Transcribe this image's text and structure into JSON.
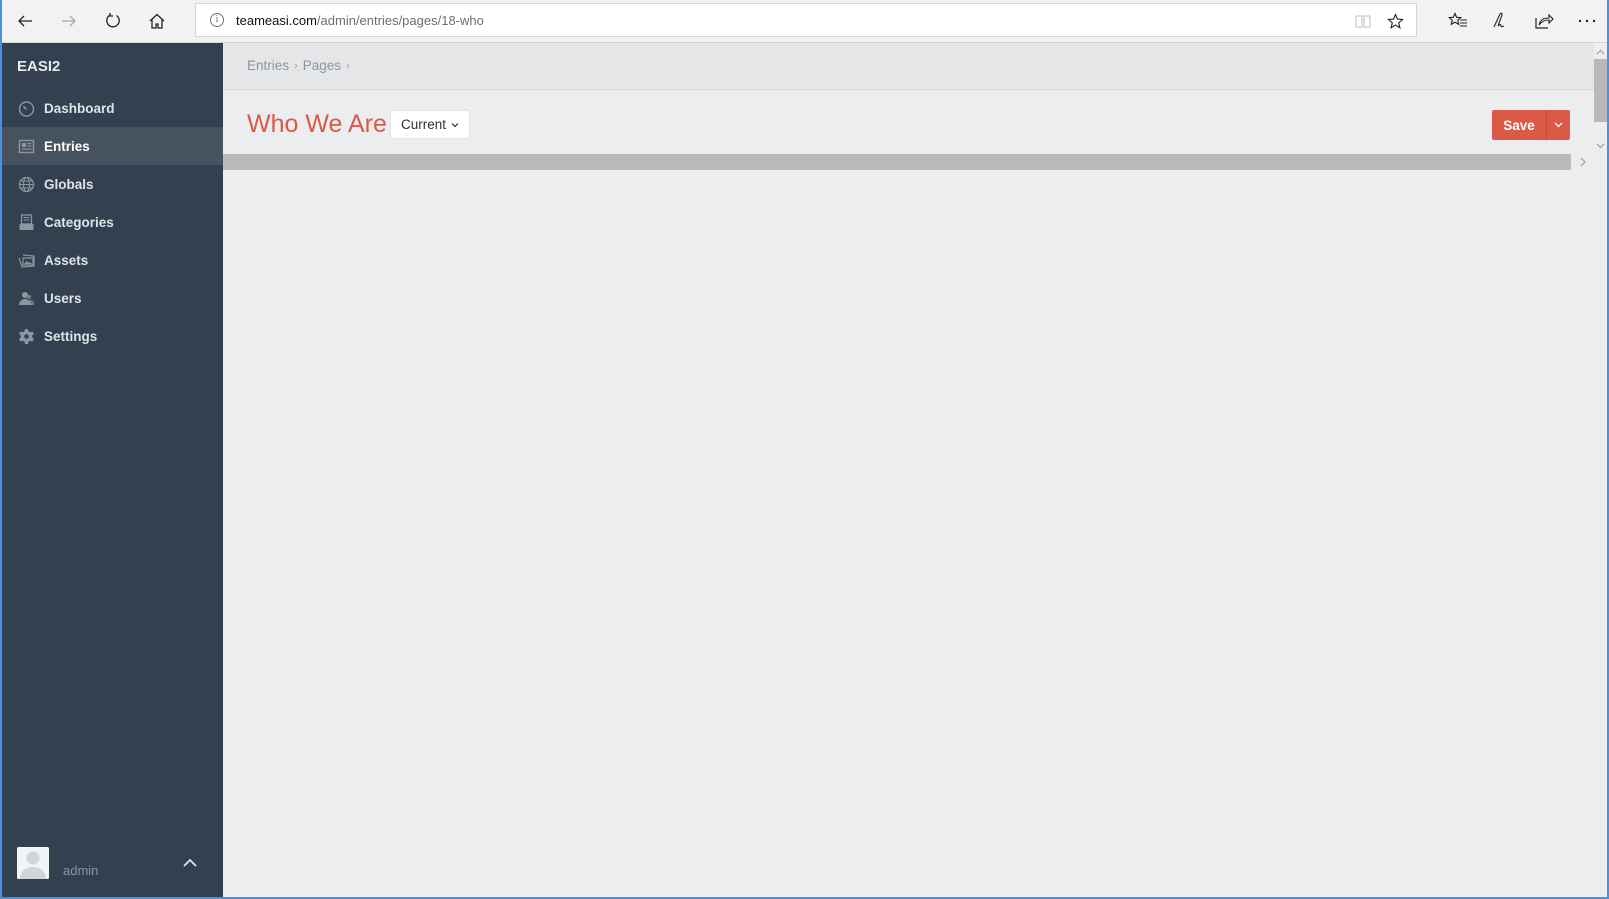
{
  "browser": {
    "url_host": "teameasi.com",
    "url_path": "/admin/entries/pages/18-who",
    "nav": {
      "back_icon": "arrow-left-icon",
      "forward_icon": "arrow-right-icon",
      "refresh_icon": "refresh-icon",
      "home_icon": "home-icon"
    },
    "toolbar_icons": [
      "reading-view-icon",
      "favorite-star-icon",
      "favorites-hub-icon",
      "web-note-icon",
      "share-icon",
      "more-icon"
    ]
  },
  "sidebar": {
    "brand": "EASI2",
    "items": [
      {
        "label": "Dashboard",
        "icon": "dashboard-gauge-icon",
        "active": false
      },
      {
        "label": "Entries",
        "icon": "entries-newspaper-icon",
        "active": true
      },
      {
        "label": "Globals",
        "icon": "globe-icon",
        "active": false
      },
      {
        "label": "Categories",
        "icon": "categories-tray-icon",
        "active": false
      },
      {
        "label": "Assets",
        "icon": "assets-image-icon",
        "active": false
      },
      {
        "label": "Users",
        "icon": "users-icon",
        "active": false
      },
      {
        "label": "Settings",
        "icon": "gear-icon",
        "active": false
      }
    ],
    "user": {
      "name": "admin",
      "toggle_icon": "chevron-up-icon"
    }
  },
  "main": {
    "breadcrumb": [
      "Entries",
      "Pages"
    ],
    "title": "Who We Are",
    "revision_label": "Current",
    "save_label": "Save"
  },
  "colors": {
    "accent": "#da5a47",
    "sidebar_bg": "#33404f",
    "sidebar_active": "#47525f",
    "main_bg": "#ebedef"
  }
}
